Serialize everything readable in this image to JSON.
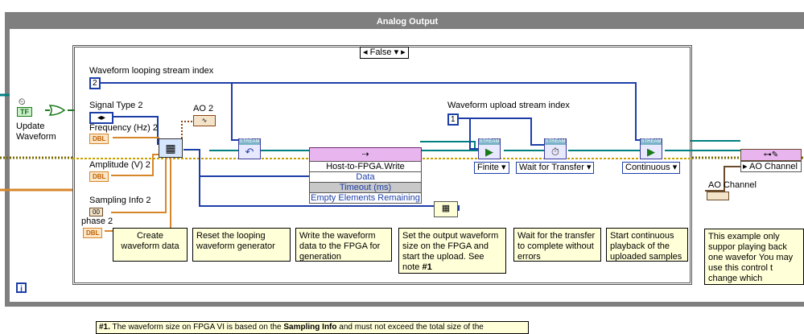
{
  "window": {
    "title": "Analog Output"
  },
  "case_structure": {
    "selector_value": "False",
    "prev_arrow": "◂",
    "next_arrow": "▸",
    "dropdown_arrow": "▾"
  },
  "labels": {
    "looping_index": "Waveform looping stream index",
    "upload_index": "Waveform upload stream index",
    "signal_type": "Signal Type 2",
    "frequency": "Frequency (Hz) 2",
    "amplitude": "Amplitude (V) 2",
    "sampling_info": "Sampling Info 2",
    "phase": "phase 2",
    "ao2": "AO  2",
    "update_waveform": "Update Waveform",
    "ao_channel_control": "AO Channel"
  },
  "constants": {
    "looping_index": "2",
    "upload_index": "1",
    "dbl": "DBL",
    "tf": "TF",
    "cluster": "00",
    "signal_arrows": "◂▸"
  },
  "fifo_write": {
    "title": "Host-to-FPGA.Write",
    "data": "Data",
    "timeout": "Timeout (ms)",
    "empty_remaining": "Empty Elements Remaining"
  },
  "rings": {
    "finite": "Finite",
    "wait_for_transfer": "Wait for Transfer",
    "continuous": "Continuous",
    "ao_channel": "AO Channel"
  },
  "stream_node": {
    "header": "STREAM"
  },
  "comments": {
    "create_waveform": "Create waveform data",
    "reset_generator": "Reset the looping waveform generator",
    "write_fpga": "Write the waveform data to the FPGA for generation",
    "set_size": "Set the output waveform size on the FPGA and start the upload.   See note ",
    "set_size_note": "#1",
    "wait_transfer": "Wait for the transfer to complete without errors",
    "start_playback": "Start continuous playback of the uploaded samples",
    "example_support": "This example only suppor playing back one wavefor You may use this control t change which channel(s) data."
  },
  "note": {
    "prefix": "#1.",
    "text_a": " The waveform size on FPGA VI is based on the ",
    "bold": "Sampling Info",
    "text_b": " and must not exceed the total size of the"
  },
  "info_icon_label": "i",
  "colors": {
    "outer_frame": "#7f7f7f",
    "wire_blue": "#1d3ea8",
    "wire_orange": "#d7862a",
    "wire_green": "#008080",
    "wire_olive": "#7a6a00",
    "comment_bg": "#ffffd8",
    "fifo_header": "#e8b5ee"
  }
}
